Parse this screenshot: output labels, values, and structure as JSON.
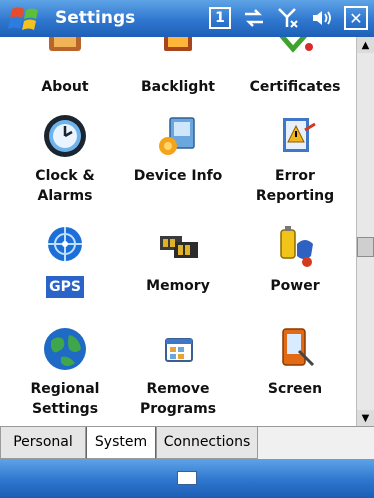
{
  "title_bar": {
    "title": "Settings",
    "icons": [
      "start-flag-icon",
      "sim-icon",
      "connectivity-icon",
      "signal-icon",
      "volume-icon",
      "close-icon"
    ],
    "sim_label": "1"
  },
  "settings_items": [
    {
      "label": "About",
      "icon": "about-icon"
    },
    {
      "label": "Backlight",
      "icon": "backlight-icon"
    },
    {
      "label": "Certificates",
      "icon": "certificates-icon"
    },
    {
      "label": "Clock &\nAlarms",
      "icon": "clock-icon"
    },
    {
      "label": "Device Info",
      "icon": "device-info-icon"
    },
    {
      "label": "Error\nReporting",
      "icon": "error-reporting-icon"
    },
    {
      "label": "GPS",
      "icon": "gps-icon",
      "selected": true
    },
    {
      "label": "Memory",
      "icon": "memory-icon"
    },
    {
      "label": "Power",
      "icon": "power-icon"
    },
    {
      "label": "Regional\nSettings",
      "icon": "regional-settings-icon"
    },
    {
      "label": "Remove\nPrograms",
      "icon": "remove-programs-icon"
    },
    {
      "label": "Screen",
      "icon": "screen-icon"
    }
  ],
  "tabs": [
    {
      "label": "Personal"
    },
    {
      "label": "System",
      "active": true
    },
    {
      "label": "Connections"
    }
  ],
  "bottom_bar": {
    "icon": "keyboard-icon"
  },
  "colors": {
    "title_bar": "#2f77cf",
    "selection": "#2a64c8"
  }
}
